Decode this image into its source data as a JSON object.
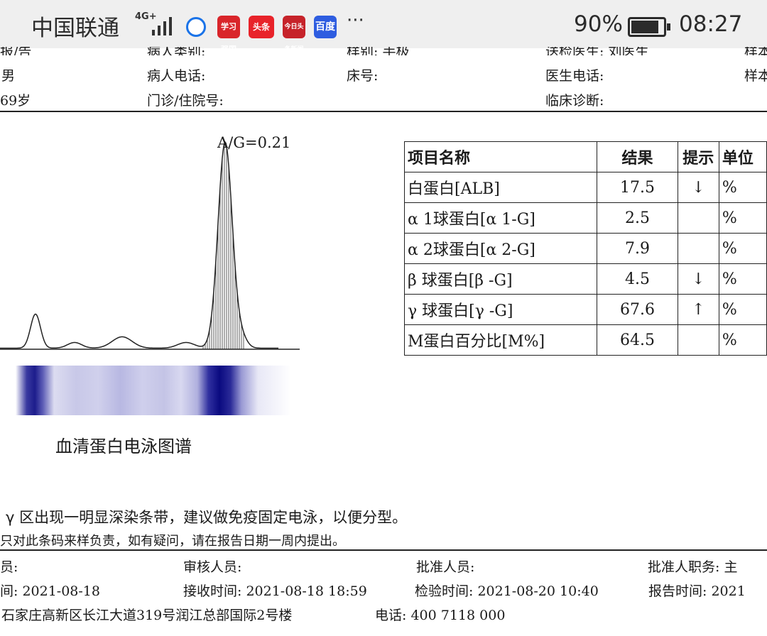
{
  "status_bar": {
    "carrier": "中国联通",
    "network": "4G+",
    "apps": [
      "学习强国",
      "头条",
      "今日头条新闻",
      "百度"
    ],
    "more": "···",
    "battery": "90%",
    "battery_level": 0.9,
    "time": "08:27"
  },
  "patient": {
    "cut_row": [
      "报/告",
      "病人类别:",
      "样别: 手极",
      "送检医生: 刘医生",
      "样本"
    ],
    "gender": "男",
    "phone_label": "病人电话:",
    "bed_label": "床号:",
    "doctor_phone_label": "医生电话:",
    "sample_label": "样本",
    "age": "69岁",
    "outpatient_label": "门诊/住院号:",
    "diagnosis_label": "临床诊断:"
  },
  "chart_data": {
    "type": "line",
    "title": "",
    "annotation": "A/G=0.21",
    "caption": "血清蛋白电泳图谱",
    "xlabel": "",
    "ylabel": "",
    "peaks": [
      {
        "fraction": "ALB",
        "percent": 17.5
      },
      {
        "fraction": "α1",
        "percent": 2.5
      },
      {
        "fraction": "α2",
        "percent": 7.9
      },
      {
        "fraction": "β",
        "percent": 4.5
      },
      {
        "fraction": "γ",
        "percent": 67.6
      }
    ],
    "m_protein_percent": 64.5,
    "grid": false
  },
  "table": {
    "headers": [
      "项目名称",
      "结果",
      "提示",
      "单位"
    ],
    "rows": [
      {
        "name": "白蛋白[ALB]",
        "result": "17.5",
        "flag": "↓",
        "unit": "%"
      },
      {
        "name": "α 1球蛋白[α 1-G]",
        "result": "2.5",
        "flag": "",
        "unit": "%"
      },
      {
        "name": "α 2球蛋白[α 2-G]",
        "result": "7.9",
        "flag": "",
        "unit": "%"
      },
      {
        "name": "β 球蛋白[β -G]",
        "result": "4.5",
        "flag": "↓",
        "unit": "%"
      },
      {
        "name": "γ 球蛋白[γ -G]",
        "result": "67.6",
        "flag": "↑",
        "unit": "%"
      },
      {
        "name": "M蛋白百分比[M%]",
        "result": "64.5",
        "flag": "",
        "unit": "%"
      }
    ]
  },
  "remark": "γ 区出现一明显深染条带，建议做免疫固定电泳，以便分型。",
  "disclaimer": "只对此条码来样负责，如有疑问，请在报告日期一周内提出。",
  "footer": {
    "inspector_label": "员:",
    "reviewer_label": "审核人员:",
    "approver_label": "批准人员:",
    "approver_title_label": "批准人职务: 主",
    "collect_time": "间: 2021-08-18",
    "receive_time": "接收时间: 2021-08-18 18:59",
    "test_time": "检验时间: 2021-08-20 10:40",
    "report_time": "报告时间: 2021",
    "address": "石家庄高新区长江大道319号润江总部国际2号楼",
    "phone": "电话: 400 7118 000"
  }
}
